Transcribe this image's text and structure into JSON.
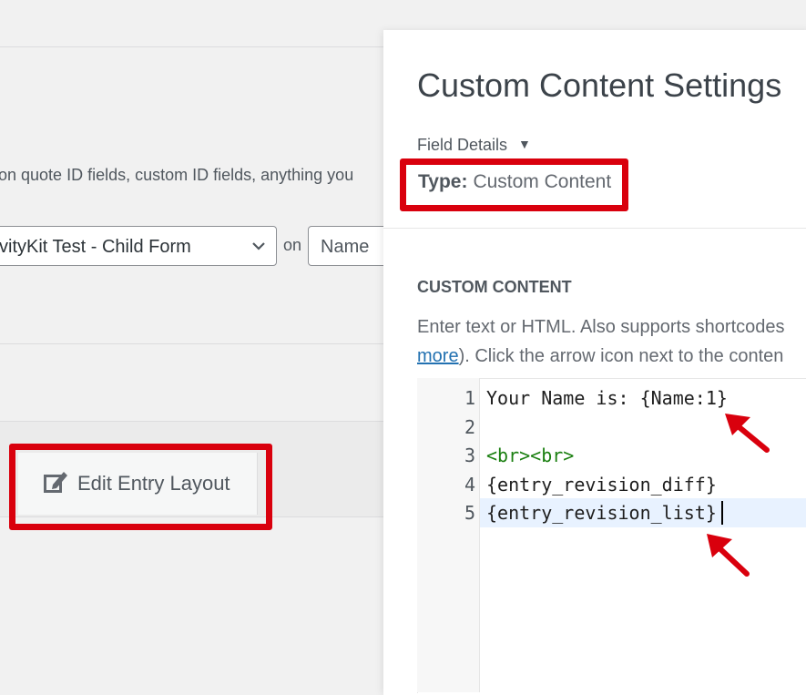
{
  "background": {
    "description_text": "on quote ID fields, custom ID fields, anything you",
    "form_select_value": "vityKit Test - Child Form",
    "on_label": "on",
    "field_select_value": "Name",
    "edit_entry_tab_label": "Edit Entry Layout"
  },
  "modal": {
    "title": "Custom Content Settings",
    "field_details_label": "Field Details",
    "type_key": "Type:",
    "type_value": "Custom Content",
    "section_heading": "CUSTOM CONTENT",
    "help_line1": "Enter text or HTML. Also supports shortcodes",
    "help_link": "more",
    "help_line2_rest": "). Click the arrow icon next to the conten"
  },
  "editor": {
    "line_numbers": [
      "1",
      "2",
      "3",
      "4",
      "5"
    ],
    "lines": [
      "Your Name is: {Name:1}",
      "",
      "<br><br>",
      "{entry_revision_diff}",
      "{entry_revision_list}"
    ]
  },
  "colors": {
    "highlight": "#d9000d",
    "link": "#2271b1",
    "active_line": "#e8f2ff",
    "tag_text": "#1a7f10"
  },
  "icons": [
    "chevron-down-icon",
    "edit-icon",
    "caret-down-icon",
    "red-arrow-icon"
  ]
}
